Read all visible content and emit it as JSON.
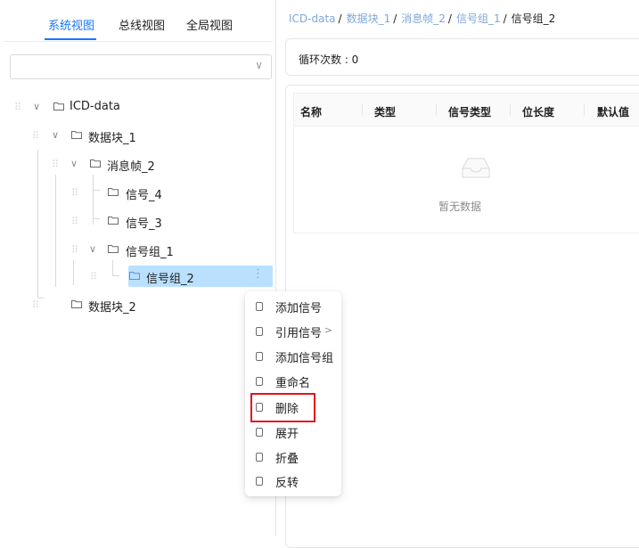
{
  "tabs": [
    {
      "label": "系统视图",
      "active": true
    },
    {
      "label": "总线视图",
      "active": false
    },
    {
      "label": "全局视图",
      "active": false
    }
  ],
  "select": {
    "value": ""
  },
  "tree": [
    {
      "label": "ICD-data",
      "expanded": true
    },
    {
      "label": "数据块_1",
      "expanded": true
    },
    {
      "label": "消息帧_2",
      "expanded": true
    },
    {
      "label": "信号_4"
    },
    {
      "label": "信号_3"
    },
    {
      "label": "信号组_1",
      "expanded": true
    },
    {
      "label": "信号组_2",
      "selected": true
    },
    {
      "label": "数据块_2"
    }
  ],
  "context_menu": {
    "items": [
      {
        "label": "添加信号"
      },
      {
        "label": "引用信号",
        "submenu": ">"
      },
      {
        "label": "添加信号组"
      },
      {
        "label": "重命名"
      },
      {
        "label": "删除",
        "highlighted": true
      },
      {
        "label": "展开"
      },
      {
        "label": "折叠"
      },
      {
        "label": "反转"
      }
    ]
  },
  "breadcrumb": {
    "items": [
      "ICD-data",
      "数据块_1",
      "消息帧_2",
      "信号组_1"
    ],
    "current": "信号组_2",
    "separator": "/"
  },
  "loop": {
    "label": "循环次数 : 0"
  },
  "table": {
    "columns": [
      "名称",
      "类型",
      "信号类型",
      "位长度",
      "默认值"
    ],
    "empty_text": "暂无数据"
  },
  "colors": {
    "accent": "#1677ff",
    "selected_bg": "#bae0ff",
    "highlight_border": "#e2141c",
    "link": "#7fa6d9"
  }
}
